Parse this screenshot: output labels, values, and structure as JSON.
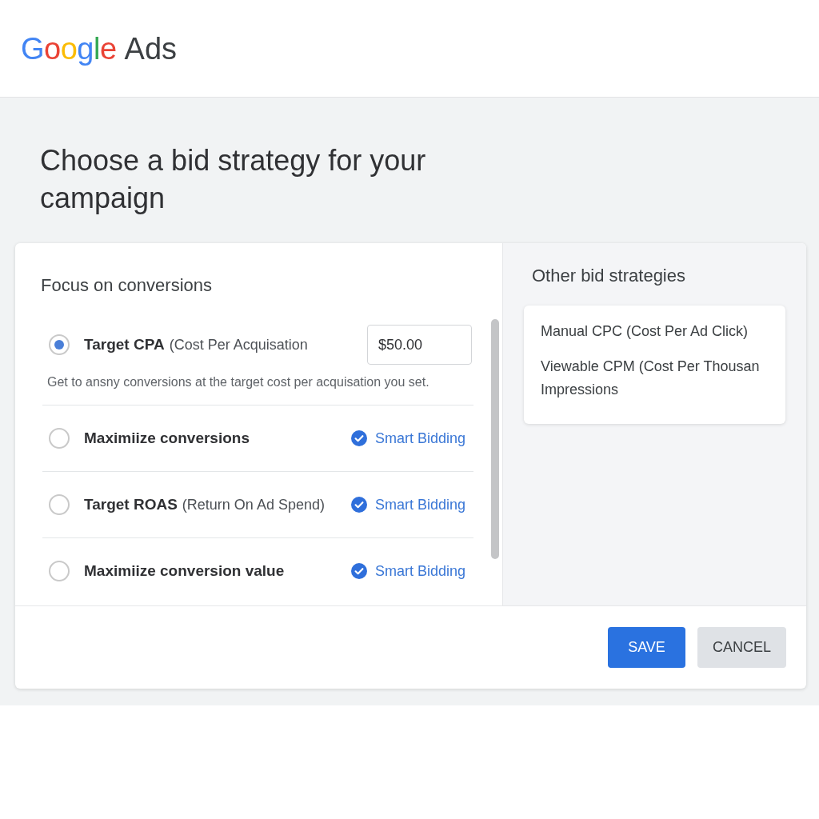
{
  "header": {
    "logo": {
      "brand": "Google",
      "product": "Ads"
    }
  },
  "page": {
    "title": "Choose a bid strategy for your campaign"
  },
  "focus_panel": {
    "heading": "Focus on conversions",
    "options": [
      {
        "kind": "amount",
        "name": "Target CPA",
        "detail": "(Cost Per Acquisation",
        "selected": true,
        "amount": "$50.00",
        "description": "Get to ansny conversions at the target cost per acquisation you set."
      },
      {
        "kind": "smart",
        "name": "Maximiize conversions",
        "selected": false,
        "badge": "Smart Bidding"
      },
      {
        "kind": "smart",
        "name": "Target ROAS",
        "detail": "(Return On Ad Spend)",
        "selected": false,
        "badge": "Smart Bidding"
      },
      {
        "kind": "smart",
        "name": "Maximiize conversion value",
        "selected": false,
        "badge": "Smart Bidding"
      }
    ]
  },
  "other_panel": {
    "heading": "Other bid strategies",
    "strategies": [
      "Manual CPC (Cost Per Ad Click)",
      "Viewable CPM (Cost Per Thousan Impressions"
    ]
  },
  "footer": {
    "buttons": [
      {
        "label": "SAVE",
        "kind": "primary"
      },
      {
        "label": "CANCEL",
        "kind": "secondary"
      }
    ]
  }
}
